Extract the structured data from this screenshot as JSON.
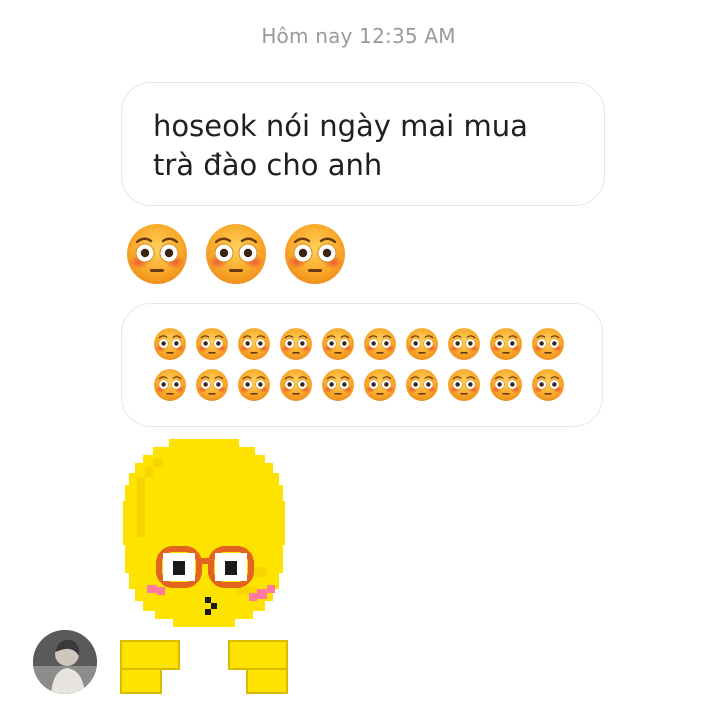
{
  "header": {
    "timestamp": "Hôm nay 12:35 AM"
  },
  "messages": [
    {
      "type": "text",
      "text": "hoseok nói ngày mai mua trà đào cho anh"
    },
    {
      "type": "emoji",
      "emoji": "😳",
      "count": 3,
      "icon": "flushed-face-icon"
    },
    {
      "type": "emoji-bubble",
      "emoji": "😳",
      "count": 20,
      "icon": "flushed-face-icon"
    },
    {
      "type": "sticker",
      "icon": "pixel-shy-emoji-sticker"
    }
  ],
  "avatar": {
    "icon": "user-avatar"
  },
  "colors": {
    "emoji_face": "#f7b733",
    "emoji_blush": "#f36a4a",
    "sticker_yellow": "#ffe300",
    "bubble_border": "#e8e8e8",
    "timestamp": "#9a9a9a"
  }
}
